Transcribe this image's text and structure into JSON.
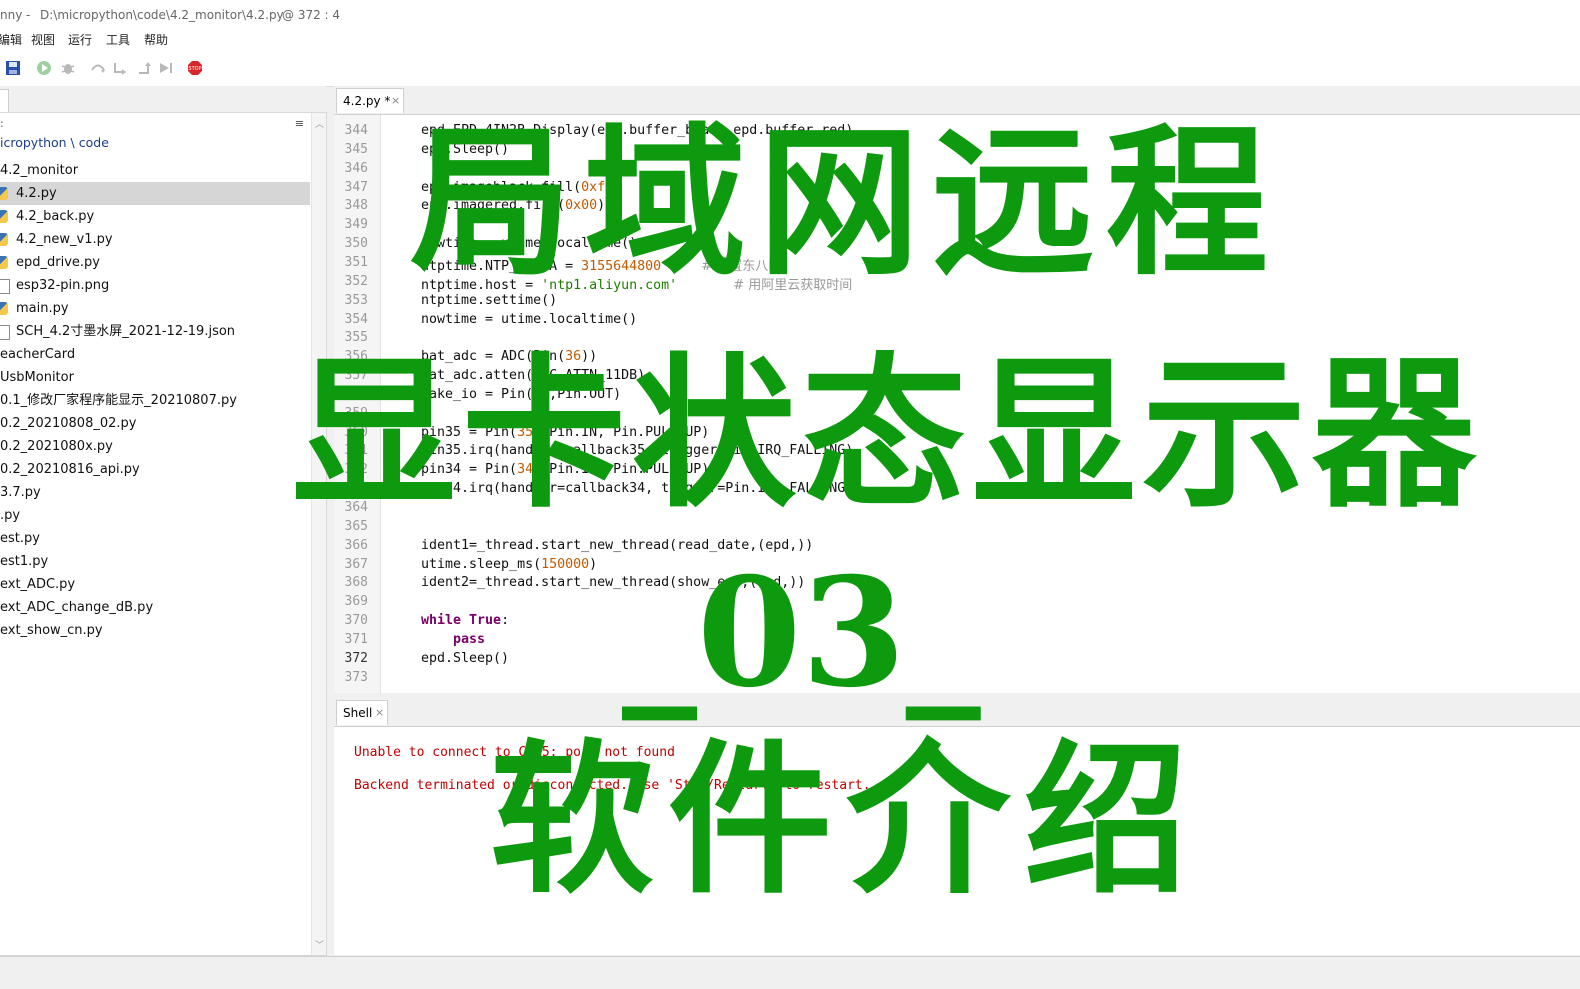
{
  "window": {
    "title_app": "nny",
    "title_path": "D:\\micropython\\code\\4.2_monitor\\4.2.py",
    "title_pos": "@  372 : 4"
  },
  "menu": [
    "编辑",
    "视图",
    "运行",
    "工具",
    "帮助"
  ],
  "files": {
    "path": "icropython \\ code",
    "menu_glyph": "≡",
    "items": [
      {
        "name": "4.2_monitor",
        "icon": "folder"
      },
      {
        "name": "4.2.py",
        "icon": "python-file-icon",
        "selected": true
      },
      {
        "name": "4.2_back.py",
        "icon": "python-file-icon"
      },
      {
        "name": "4.2_new_v1.py",
        "icon": "python-file-icon"
      },
      {
        "name": "epd_drive.py",
        "icon": "python-file-icon"
      },
      {
        "name": "esp32-pin.png",
        "icon": "file-icon"
      },
      {
        "name": "main.py",
        "icon": "python-file-icon"
      },
      {
        "name": "SCH_4.2寸墨水屏_2021-12-19.json",
        "icon": "document-icon"
      },
      {
        "name": "eacherCard",
        "icon": "folder"
      },
      {
        "name": "UsbMonitor",
        "icon": "folder"
      },
      {
        "name": "0.1_修改厂家程序能显示_20210807.py",
        "icon": "folder"
      },
      {
        "name": "0.2_20210808_02.py",
        "icon": "folder"
      },
      {
        "name": "0.2_2021080x.py",
        "icon": "folder"
      },
      {
        "name": "0.2_20210816_api.py",
        "icon": "folder"
      },
      {
        "name": "3.7.py",
        "icon": "folder"
      },
      {
        "name": ".py",
        "icon": "folder"
      },
      {
        "name": "est.py",
        "icon": "folder"
      },
      {
        "name": "est1.py",
        "icon": "folder"
      },
      {
        "name": "ext_ADC.py",
        "icon": "folder"
      },
      {
        "name": "ext_ADC_change_dB.py",
        "icon": "folder"
      },
      {
        "name": "ext_show_cn.py",
        "icon": "folder"
      }
    ]
  },
  "editor": {
    "tab_label": "4.2.py *",
    "tab_close": "×",
    "current_line": 372,
    "lines": [
      {
        "n": 344,
        "t": [
          [
            "",
            "epd.EPD_4IN2B_Display(epd.buffer_black,epd.buffer_red)"
          ]
        ]
      },
      {
        "n": 345,
        "t": [
          [
            "",
            "epd.Sleep()"
          ]
        ]
      },
      {
        "n": 346,
        "t": []
      },
      {
        "n": 347,
        "t": [
          [
            "",
            "epd.imageblack.fill("
          ],
          [
            "num",
            "0xff"
          ],
          [
            "",
            ")"
          ]
        ]
      },
      {
        "n": 348,
        "t": [
          [
            "",
            "epd.imagered.fill("
          ],
          [
            "num",
            "0x00"
          ],
          [
            "",
            ")"
          ]
        ]
      },
      {
        "n": 349,
        "t": []
      },
      {
        "n": 350,
        "t": [
          [
            "",
            "nowtime = utime.localtime()"
          ]
        ]
      },
      {
        "n": 351,
        "t": [
          [
            "",
            "ntptime.NTP_DELTA = "
          ],
          [
            "num",
            "3155644800"
          ],
          [
            "",
            "     "
          ],
          [
            "cmt",
            "# 设置东八区"
          ]
        ]
      },
      {
        "n": 352,
        "t": [
          [
            "",
            "ntptime.host = "
          ],
          [
            "str",
            "'ntp1.aliyun.com'"
          ],
          [
            "",
            "       "
          ],
          [
            "cmt",
            "# 用阿里云获取时间"
          ]
        ]
      },
      {
        "n": 353,
        "t": [
          [
            "",
            "ntptime.settime()"
          ]
        ]
      },
      {
        "n": 354,
        "t": [
          [
            "",
            "nowtime = utime.localtime()"
          ]
        ]
      },
      {
        "n": 355,
        "t": []
      },
      {
        "n": 356,
        "t": [
          [
            "",
            "bat_adc = ADC(Pin("
          ],
          [
            "num",
            "36"
          ],
          [
            "",
            "))"
          ]
        ]
      },
      {
        "n": 357,
        "t": [
          [
            "",
            "bat_adc.atten(ADC.ATTN_11DB)"
          ]
        ]
      },
      {
        "n": 358,
        "t": [
          [
            "",
            "wake_io = Pin("
          ],
          [
            "num",
            "25"
          ],
          [
            "",
            ",Pin.OUT)"
          ]
        ]
      },
      {
        "n": 359,
        "t": []
      },
      {
        "n": 360,
        "t": [
          [
            "",
            "pin35 = Pin("
          ],
          [
            "num",
            "35"
          ],
          [
            "",
            ", Pin.IN, Pin.PULL_UP)"
          ]
        ]
      },
      {
        "n": 361,
        "t": [
          [
            "",
            "pin35.irq(handler=callback35, trigger=Pin.IRQ_FALLING)"
          ]
        ]
      },
      {
        "n": 362,
        "t": [
          [
            "",
            "pin34 = Pin("
          ],
          [
            "num",
            "34"
          ],
          [
            "",
            ", Pin.IN, Pin.PULL_UP)"
          ]
        ]
      },
      {
        "n": 363,
        "t": [
          [
            "",
            "pin34.irq(handler=callback34, trigger=Pin.IRQ_FALLING)"
          ]
        ]
      },
      {
        "n": 364,
        "t": []
      },
      {
        "n": 365,
        "t": []
      },
      {
        "n": 366,
        "t": [
          [
            "",
            "ident1=_thread.start_new_thread(read_date,(epd,))"
          ]
        ]
      },
      {
        "n": 367,
        "t": [
          [
            "",
            "utime.sleep_ms("
          ],
          [
            "num",
            "150000"
          ],
          [
            "",
            ")"
          ]
        ]
      },
      {
        "n": 368,
        "t": [
          [
            "",
            "ident2=_thread.start_new_thread(show_epd,(epd,))"
          ]
        ]
      },
      {
        "n": 369,
        "t": []
      },
      {
        "n": 370,
        "t": [
          [
            "kw",
            "while True"
          ],
          [
            "",
            ":"
          ]
        ]
      },
      {
        "n": 371,
        "t": [
          [
            "",
            "    "
          ],
          [
            "kw",
            "pass"
          ]
        ]
      },
      {
        "n": 372,
        "t": [
          [
            "",
            "epd.Sleep()"
          ]
        ]
      },
      {
        "n": 373,
        "t": []
      }
    ]
  },
  "shell": {
    "tab_label": "Shell",
    "tab_close": "×",
    "lines": [
      "Unable to connect to COM5: port not found",
      "Backend terminated or disconnected. Use 'Stop/Restart' to restart."
    ]
  },
  "overlay": {
    "line1": "局域网远程",
    "line2": "显卡状态显示器",
    "line3": "_03_",
    "line4": "软件介绍",
    "color": "#0e9a0e"
  },
  "colors": {
    "keyword": "#7a0066",
    "number": "#c05a00",
    "string": "#1e7e00",
    "error": "#c00000"
  }
}
